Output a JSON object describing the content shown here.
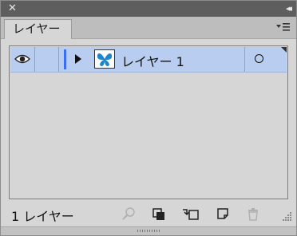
{
  "window": {
    "close_glyph": "✕",
    "collapse_glyph": "◂◂"
  },
  "tab": {
    "label": "レイヤー"
  },
  "layers": [
    {
      "name": "レイヤー 1",
      "visible": true,
      "color": "#3a6ff0",
      "thumbnail_icon": "butterfly-icon"
    }
  ],
  "footer": {
    "count_label": "1 レイヤー",
    "icons": [
      "search-icon",
      "clipping-mask-icon",
      "new-sublayer-icon",
      "new-layer-icon",
      "trash-icon"
    ]
  }
}
